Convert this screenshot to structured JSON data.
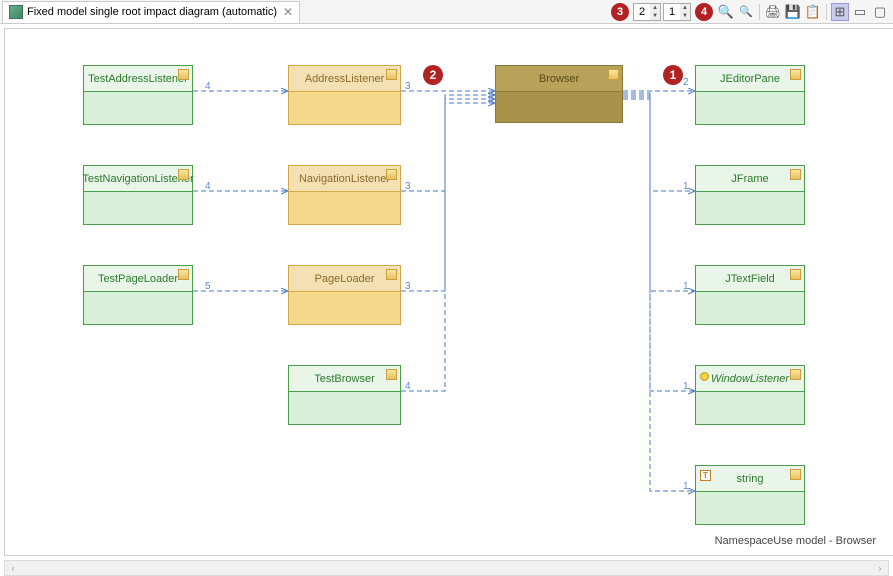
{
  "toolbar": {
    "tab_title": "Fixed model single root impact diagram (automatic)",
    "badge_3": "3",
    "badge_4": "4",
    "spinner_a": "2",
    "spinner_b": "1"
  },
  "nodes": {
    "testAddressListener": {
      "label": "TestAddressListener"
    },
    "testNavigationListener": {
      "label": "TestNavigationListener"
    },
    "testPageLoader": {
      "label": "TestPageLoader"
    },
    "addressListener": {
      "label": "AddressListener"
    },
    "navigationListener": {
      "label": "NavigationListener"
    },
    "pageLoader": {
      "label": "PageLoader"
    },
    "testBrowser": {
      "label": "TestBrowser"
    },
    "browser": {
      "label": "Browser"
    },
    "jEditorPane": {
      "label": "JEditorPane"
    },
    "jFrame": {
      "label": "JFrame"
    },
    "jTextField": {
      "label": "JTextField"
    },
    "windowListener": {
      "label": "WindowListener"
    },
    "string": {
      "label": "string"
    }
  },
  "edges": {
    "e1": "4",
    "e2": "4",
    "e3": "5",
    "e4": "3",
    "e5": "3",
    "e6": "3",
    "e7": "4",
    "e8": "2",
    "e9": "1",
    "e10": "1",
    "e11": "1",
    "e12": "1"
  },
  "diagram_badges": {
    "b1": "1",
    "b2": "2"
  },
  "footer": "NamespaceUse model - Browser"
}
